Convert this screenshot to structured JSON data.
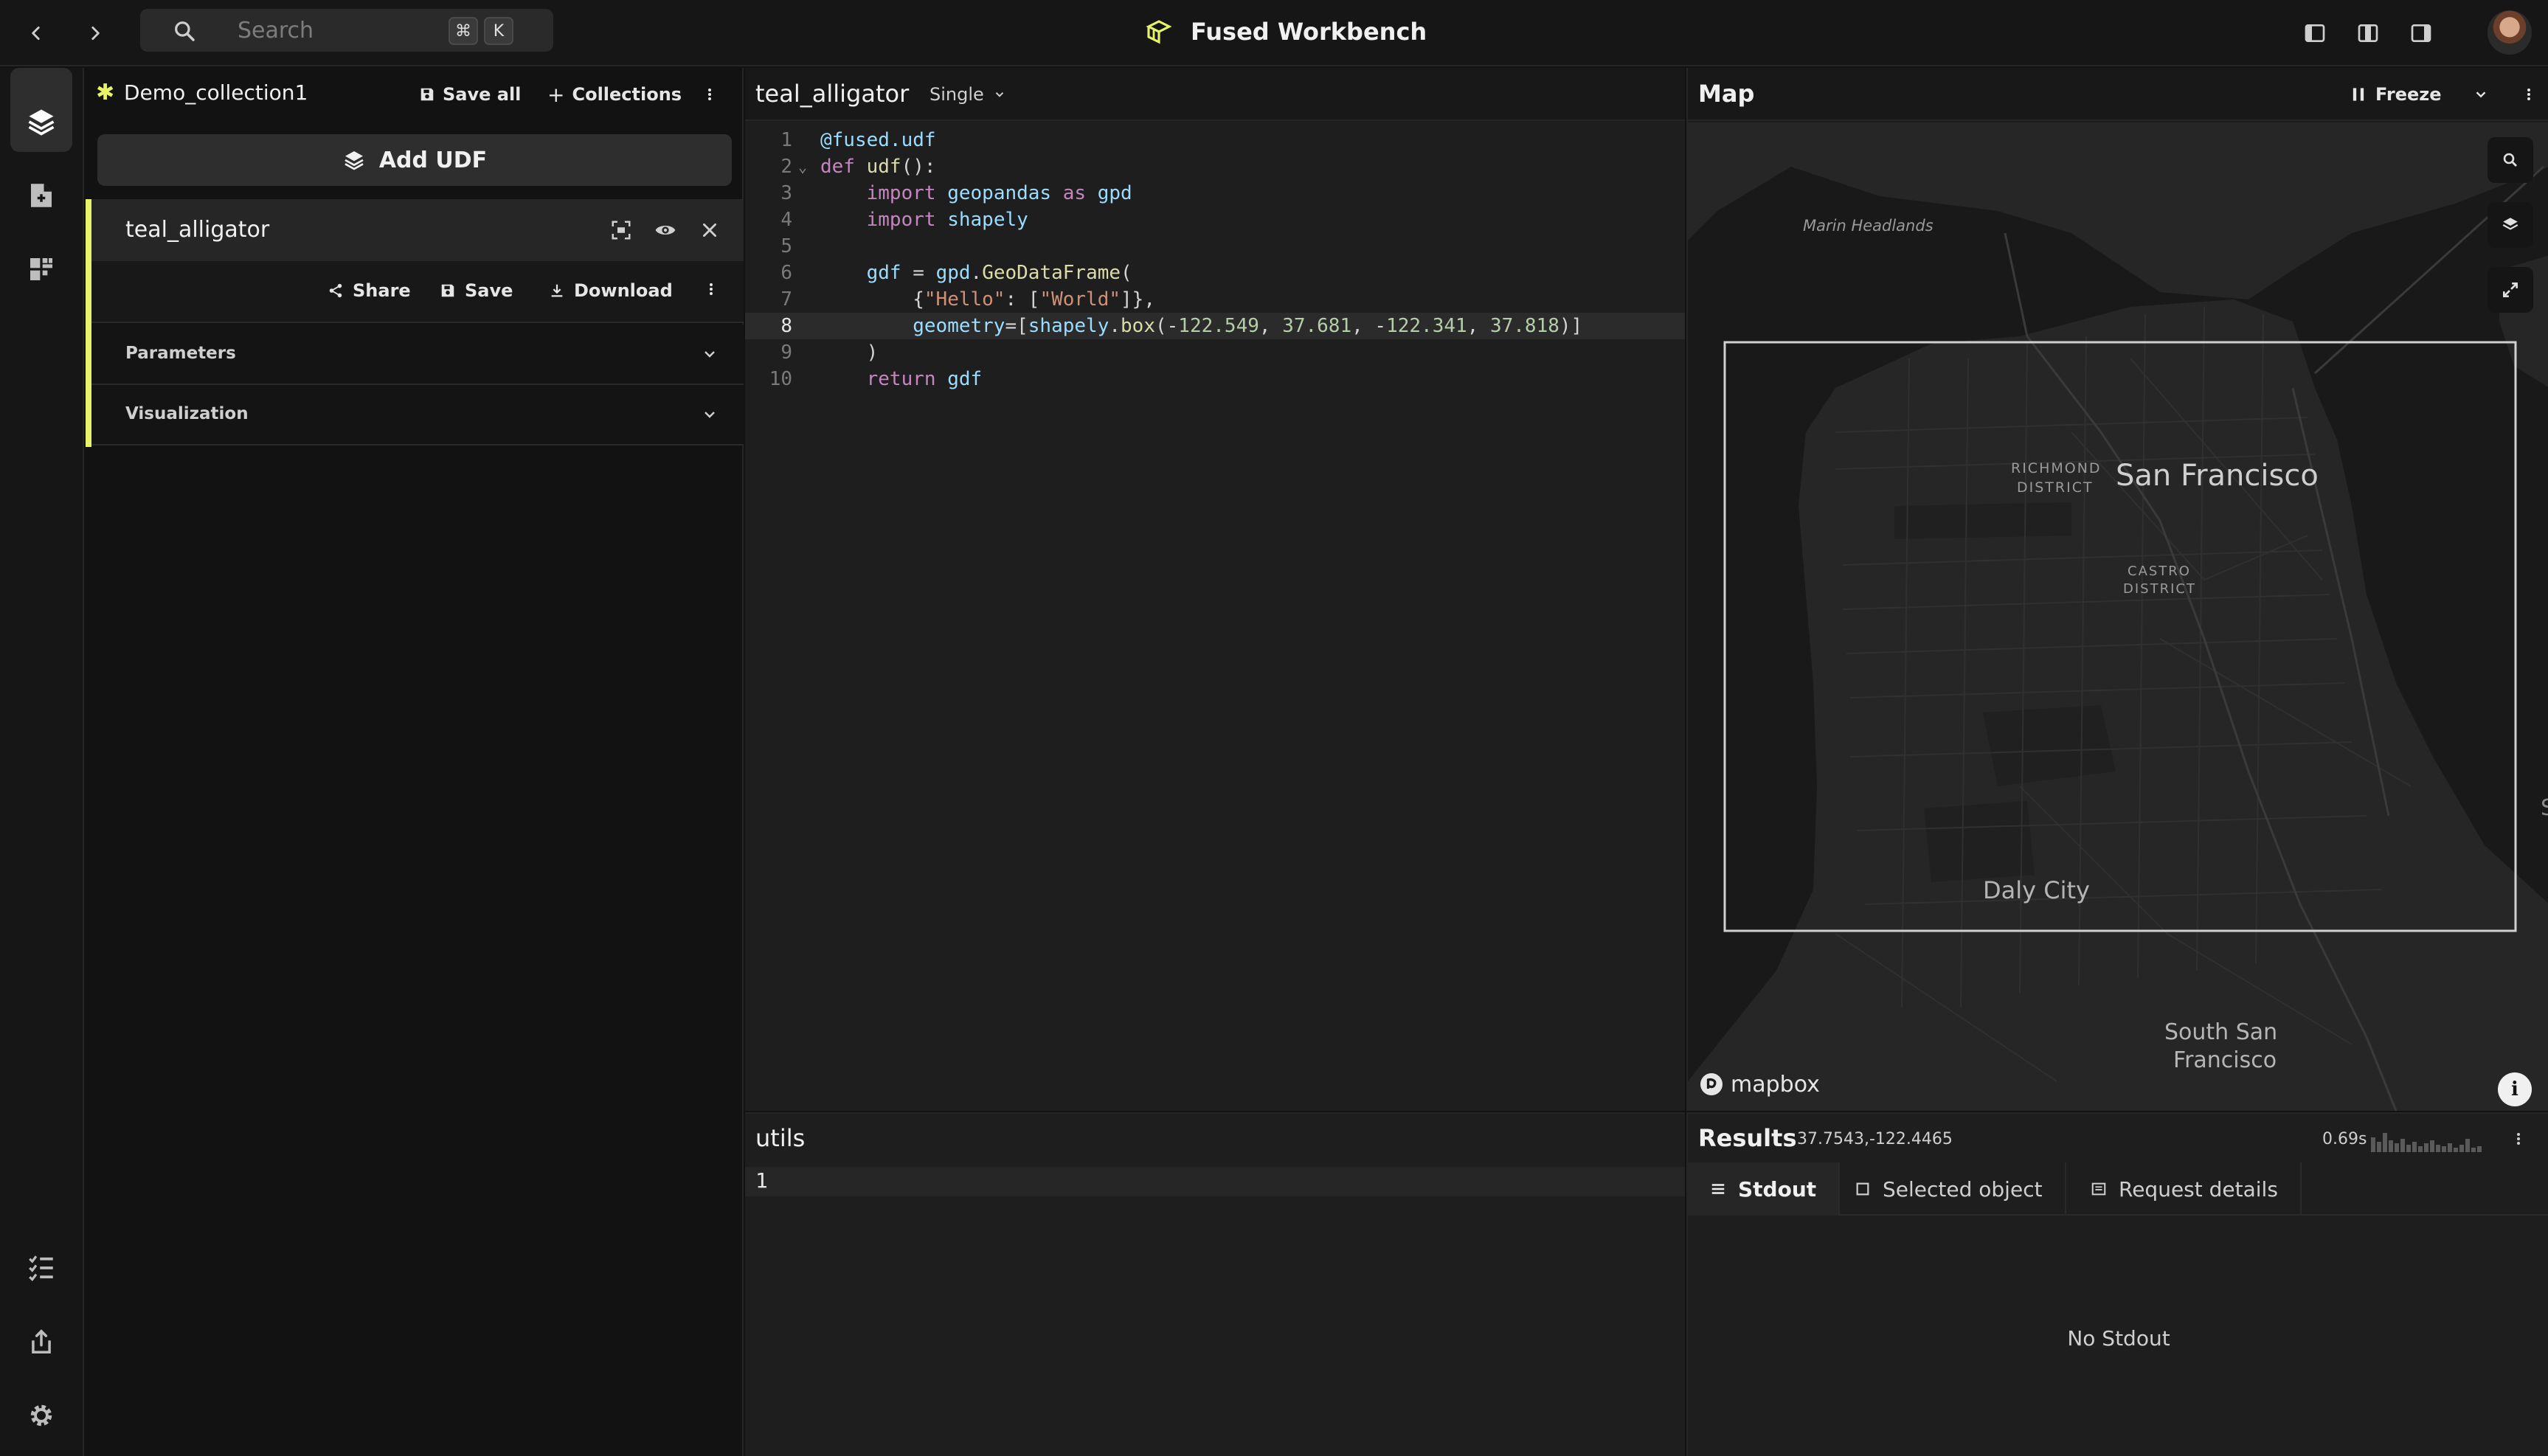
{
  "topbar": {
    "search_placeholder": "Search",
    "shortcut_mod": "⌘",
    "shortcut_key": "K",
    "app_title": "Fused Workbench"
  },
  "collection": {
    "name": "Demo_collection1",
    "save_all": "Save all",
    "collections": "Collections",
    "add_udf": "Add UDF"
  },
  "udf": {
    "name": "teal_alligator",
    "share": "Share",
    "save": "Save",
    "download": "Download",
    "sections": [
      "Parameters",
      "Visualization"
    ]
  },
  "editor": {
    "title": "teal_alligator",
    "mode": "Single",
    "line_numbers": [
      "1",
      "2",
      "3",
      "4",
      "5",
      "6",
      "7",
      "8",
      "9",
      "10"
    ],
    "highlighted_line": 8
  },
  "utils": {
    "title": "utils",
    "line_number": "1"
  },
  "map": {
    "title": "Map",
    "freeze": "Freeze",
    "places": {
      "marin": "Marin Headlands",
      "richmond_1": "RICHMOND",
      "richmond_2": "DISTRICT",
      "sf": "San Francisco",
      "castro_1": "CASTRO",
      "castro_2": "DISTRICT",
      "daly": "Daly City",
      "ssf_1": "South San",
      "ssf_2": "Francisco",
      "edge": "S"
    },
    "attribution": "mapbox"
  },
  "results": {
    "title": "Results",
    "coords": "37.7543,-122.4465",
    "time": "0.69s",
    "tabs": [
      "Stdout",
      "Selected object",
      "Request details"
    ],
    "empty": "No Stdout"
  },
  "colors": {
    "accent": "#e8f36a",
    "background": "#121212",
    "panel": "#1e1e1e"
  },
  "icons": [
    "back-icon",
    "forward-icon",
    "search-icon",
    "fused-logo-icon",
    "layout-left-icon",
    "layout-center-icon",
    "layout-right-icon",
    "layers-icon",
    "file-add-icon",
    "grid-icon",
    "checklist-icon",
    "share-out-icon",
    "gear-icon"
  ]
}
